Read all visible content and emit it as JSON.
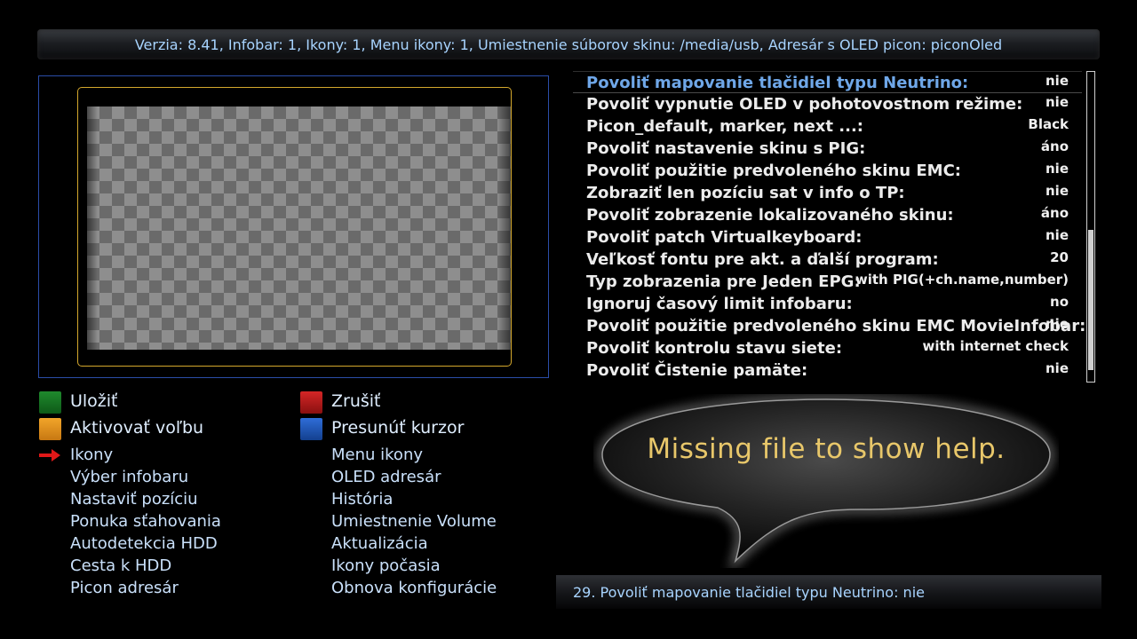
{
  "header": {
    "info": "Verzia: 8.41, Infobar: 1, Ikony: 1, Menu ikony: 1, Umiestnenie súborov skinu: /media/usb, Adresár s OLED picon: piconOled"
  },
  "settings": {
    "selected_index": 0,
    "rows": [
      {
        "label": "Povoliť mapovanie tlačidiel typu Neutrino:",
        "value": "nie"
      },
      {
        "label": "Povoliť vypnutie OLED v pohotovostnom režime:",
        "value": "nie"
      },
      {
        "label": "Picon_default, marker, next ...:",
        "value": "Black"
      },
      {
        "label": "Povoliť nastavenie skinu s PIG:",
        "value": "áno"
      },
      {
        "label": "Povoliť použitie predvoleného skinu  EMC:",
        "value": "nie"
      },
      {
        "label": "Zobraziť len pozíciu sat v info o TP:",
        "value": "nie"
      },
      {
        "label": "Povoliť zobrazenie lokalizovaného skinu:",
        "value": "áno"
      },
      {
        "label": "Povoliť patch Virtualkeyboard:",
        "value": "nie"
      },
      {
        "label": "Veľkosť fontu pre akt. a ďalší program:",
        "value": "20"
      },
      {
        "label": "Typ zobrazenia  pre Jeden EPG:",
        "value": "with PIG(+ch.name,number)"
      },
      {
        "label": "Ignoruj časový limit infobaru:",
        "value": "no"
      },
      {
        "label": "Povoliť použitie predvoleného skinu EMC MovieInfobar:",
        "value": "nie"
      },
      {
        "label": "Povoliť kontrolu stavu siete:",
        "value": "with internet check"
      },
      {
        "label": "Povoliť Čistenie pamäte:",
        "value": "nie"
      }
    ]
  },
  "keys": {
    "green": "Uložiť",
    "red": "Zrušiť",
    "yellow": "Aktivovať voľbu",
    "blue": "Presunúť kurzor"
  },
  "menu": {
    "left": [
      "Ikony",
      "Výber infobaru",
      "Nastaviť pozíciu",
      "Ponuka sťahovania",
      "Autodetekcia HDD",
      "Cesta k HDD",
      "Picon adresár"
    ],
    "right": [
      "Menu ikony",
      "OLED adresár",
      "História",
      "Umiestnenie Volume",
      "Aktualizácia",
      "Ikony počasia",
      "Obnova konfigurácie"
    ],
    "current": "Ikony"
  },
  "help": {
    "message": "Missing file to show help."
  },
  "status": {
    "text": "29. Povoliť mapovanie tlačidiel typu Neutrino: nie"
  },
  "colors": {
    "accent_blue_text": "#a8d4ff",
    "selected_label": "#6fa7e8",
    "frame_gold": "#d4a72c",
    "frame_blue": "#2a4da8",
    "help_text": "#e8c76a",
    "key_green": "#1f8a2d",
    "key_red": "#d42626",
    "key_yellow": "#f2a52a",
    "key_blue": "#2f6dd8"
  },
  "icons": {
    "current_marker": "red-arrow-right-icon"
  }
}
